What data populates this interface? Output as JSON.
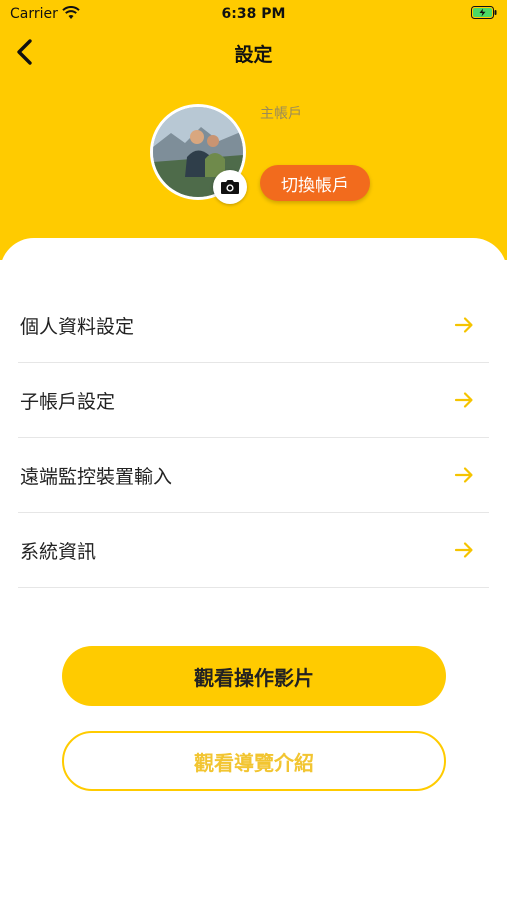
{
  "status_bar": {
    "carrier": "Carrier",
    "time": "6:38 PM"
  },
  "nav": {
    "title": "設定"
  },
  "profile": {
    "account_label": "主帳戶",
    "switch_button": "切換帳戶"
  },
  "menu": {
    "items": [
      {
        "label": "個人資料設定"
      },
      {
        "label": "子帳戶設定"
      },
      {
        "label": "遠端監控裝置輸入"
      },
      {
        "label": "系統資訊"
      }
    ]
  },
  "buttons": {
    "primary": "觀看操作影片",
    "secondary": "觀看導覽介紹"
  },
  "colors": {
    "brand_yellow": "#FFCB00",
    "accent_orange": "#F26B1D"
  },
  "icons": [
    "wifi-icon",
    "battery-icon",
    "back-arrow-icon",
    "camera-icon",
    "arrow-right-icon"
  ]
}
